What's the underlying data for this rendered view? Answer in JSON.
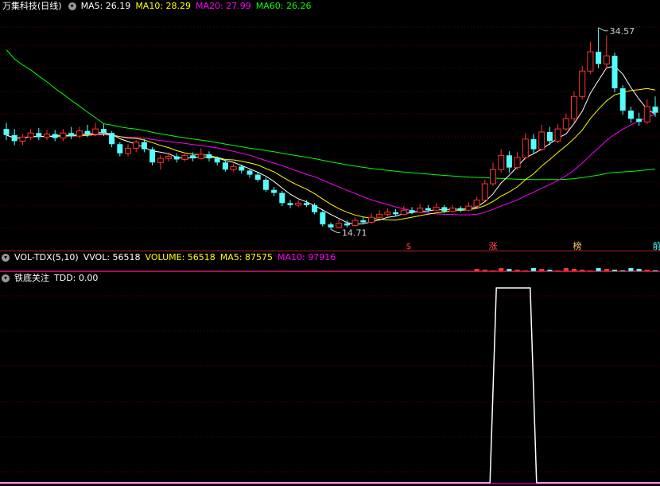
{
  "colors": {
    "up": "#ff3232",
    "down": "#54ffff",
    "ma5": "#ffffff",
    "ma10": "#ffff00",
    "ma20": "#ff00ff",
    "ma60": "#00ff00",
    "grid": "#6b0000",
    "title": "#ffffff",
    "tdd": "#ffffff"
  },
  "main": {
    "stock_name": "万集科技",
    "period": "(日线)",
    "ma5_label": "MA5: 26.19",
    "ma10_label": "MA10: 28.29",
    "ma20_label": "MA20: 27.99",
    "ma60_label": "MA60: 26.26",
    "high_label": "34.57",
    "low_label": "14.71",
    "markers": [
      {
        "text": "$",
        "color": "#ff3232",
        "name": "marker-dollar"
      },
      {
        "text": "涨",
        "color": "#ff5050",
        "name": "marker-zhang"
      },
      {
        "text": "榜",
        "color": "#ffcc66",
        "name": "marker-bang"
      },
      {
        "text": "前",
        "color": "#54ffff",
        "name": "marker-qian"
      }
    ]
  },
  "volume": {
    "indicator_name": "VOL-TDX(5,10)",
    "vvol_label": "VVOL: 56518",
    "volume_label": "VOLUME: 56518",
    "ma5_label": "MA5: 87575",
    "ma10_label": "MA10: 97916"
  },
  "indicator": {
    "name": "铁底关注",
    "tdd_label": "TDD: 0.00",
    "signal": {
      "baseline": 0,
      "peak": 1,
      "bar_index_start": 61,
      "bar_index_end": 64
    }
  },
  "chart_data": {
    "type": "candlestick",
    "high": 34.57,
    "low": 14.71,
    "candles": [
      [
        24.6,
        24.0,
        25.2,
        23.5
      ],
      [
        24.0,
        23.4,
        24.6,
        23.0
      ],
      [
        23.4,
        23.8,
        24.1,
        23.0
      ],
      [
        23.8,
        24.2,
        24.6,
        23.5
      ],
      [
        24.2,
        23.8,
        24.7,
        23.5
      ],
      [
        23.8,
        24.1,
        24.5,
        23.5
      ],
      [
        24.1,
        23.7,
        24.5,
        23.4
      ],
      [
        23.7,
        24.2,
        24.6,
        23.4
      ],
      [
        24.2,
        23.9,
        24.8,
        23.6
      ],
      [
        23.9,
        24.4,
        24.8,
        23.7
      ],
      [
        24.4,
        24.1,
        25.0,
        23.8
      ],
      [
        24.1,
        24.6,
        25.2,
        23.9
      ],
      [
        24.6,
        24.2,
        25.1,
        23.9
      ],
      [
        24.2,
        23.1,
        24.4,
        22.8
      ],
      [
        23.1,
        22.2,
        23.3,
        21.9
      ],
      [
        22.2,
        22.7,
        23.1,
        21.9
      ],
      [
        22.7,
        23.3,
        23.5,
        22.3
      ],
      [
        23.3,
        22.6,
        23.6,
        22.3
      ],
      [
        22.6,
        21.3,
        22.8,
        21.0
      ],
      [
        21.3,
        21.7,
        22.0,
        20.6
      ],
      [
        21.7,
        21.9,
        22.3,
        21.4
      ],
      [
        21.9,
        21.6,
        22.2,
        21.3
      ],
      [
        21.6,
        22.0,
        22.3,
        21.4
      ],
      [
        22.0,
        21.7,
        22.3,
        21.4
      ],
      [
        21.7,
        22.1,
        22.7,
        21.6
      ],
      [
        22.1,
        21.7,
        22.4,
        21.4
      ],
      [
        21.7,
        21.3,
        21.9,
        21.0
      ],
      [
        21.3,
        20.6,
        21.5,
        20.4
      ],
      [
        20.6,
        20.9,
        21.2,
        20.4
      ],
      [
        20.9,
        20.5,
        21.1,
        20.2
      ],
      [
        20.5,
        20.1,
        20.7,
        19.8
      ],
      [
        20.1,
        19.6,
        20.3,
        19.4
      ],
      [
        19.6,
        18.6,
        19.8,
        18.4
      ],
      [
        18.6,
        18.3,
        18.9,
        18.0
      ],
      [
        18.3,
        17.3,
        18.5,
        17.0
      ],
      [
        17.3,
        17.1,
        17.6,
        16.8
      ],
      [
        17.1,
        17.3,
        17.6,
        16.9
      ],
      [
        17.3,
        17.1,
        17.6,
        16.9
      ],
      [
        17.1,
        16.4,
        17.3,
        16.2
      ],
      [
        16.4,
        15.2,
        16.6,
        15.0
      ],
      [
        15.2,
        14.9,
        15.4,
        14.71
      ],
      [
        14.9,
        15.3,
        15.7,
        14.8
      ],
      [
        15.3,
        15.1,
        15.6,
        14.9
      ],
      [
        15.1,
        15.6,
        15.9,
        15.0
      ],
      [
        15.6,
        15.4,
        15.9,
        15.2
      ],
      [
        15.4,
        15.9,
        16.3,
        15.3
      ],
      [
        15.9,
        16.2,
        16.6,
        15.8
      ],
      [
        16.2,
        16.4,
        16.8,
        16.0
      ],
      [
        16.4,
        16.2,
        16.7,
        16.0
      ],
      [
        16.2,
        16.6,
        17.0,
        16.1
      ],
      [
        16.6,
        16.4,
        16.9,
        16.2
      ],
      [
        16.4,
        16.8,
        17.2,
        16.3
      ],
      [
        16.8,
        16.6,
        17.1,
        16.4
      ],
      [
        16.6,
        16.9,
        17.3,
        16.5
      ],
      [
        16.9,
        16.5,
        17.1,
        16.3
      ],
      [
        16.5,
        16.8,
        17.1,
        16.4
      ],
      [
        16.8,
        16.6,
        17.0,
        16.4
      ],
      [
        16.6,
        17.0,
        17.4,
        16.5
      ],
      [
        17.0,
        17.6,
        17.9,
        16.9
      ],
      [
        17.6,
        19.2,
        19.6,
        17.5
      ],
      [
        19.2,
        20.6,
        21.3,
        19.0
      ],
      [
        20.6,
        22.0,
        22.6,
        20.3
      ],
      [
        22.0,
        20.8,
        22.4,
        20.3
      ],
      [
        20.8,
        21.8,
        22.3,
        20.6
      ],
      [
        21.8,
        23.6,
        24.2,
        21.6
      ],
      [
        23.6,
        22.6,
        24.1,
        22.2
      ],
      [
        22.6,
        24.3,
        25.0,
        22.4
      ],
      [
        24.3,
        23.4,
        24.8,
        23.0
      ],
      [
        23.4,
        24.6,
        25.1,
        23.2
      ],
      [
        24.6,
        25.6,
        26.1,
        24.4
      ],
      [
        25.6,
        27.8,
        28.3,
        25.3
      ],
      [
        27.8,
        30.3,
        30.8,
        27.5
      ],
      [
        30.3,
        32.2,
        33.2,
        30.0
      ],
      [
        32.2,
        31.0,
        34.57,
        30.6
      ],
      [
        31.0,
        31.8,
        33.8,
        30.5
      ],
      [
        31.8,
        28.6,
        32.1,
        28.2
      ],
      [
        28.6,
        26.4,
        28.9,
        26.0
      ],
      [
        26.4,
        25.6,
        26.8,
        25.2
      ],
      [
        25.6,
        25.3,
        26.2,
        24.9
      ],
      [
        25.3,
        26.8,
        27.5,
        25.1
      ],
      [
        26.8,
        26.2,
        27.8,
        25.8
      ]
    ]
  }
}
